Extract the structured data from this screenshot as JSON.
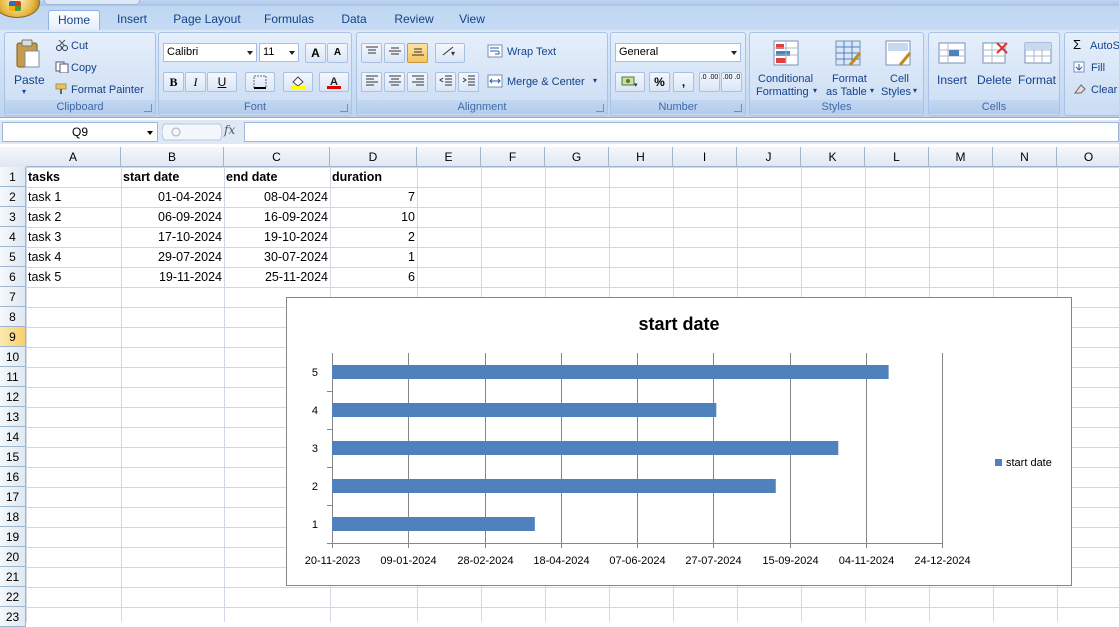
{
  "tabs": [
    {
      "label": "Home",
      "active": true
    },
    {
      "label": "Insert"
    },
    {
      "label": "Page Layout"
    },
    {
      "label": "Formulas"
    },
    {
      "label": "Data"
    },
    {
      "label": "Review"
    },
    {
      "label": "View"
    }
  ],
  "clipboard": {
    "paste": "Paste",
    "cut": "Cut",
    "copy": "Copy",
    "format_painter": "Format Painter",
    "label": "Clipboard"
  },
  "font": {
    "name": "Calibri",
    "size": "11",
    "bold": "B",
    "italic": "I",
    "underline": "U",
    "grow": "A",
    "shrink": "A",
    "label": "Font"
  },
  "alignment": {
    "wrap_text": "Wrap Text",
    "merge_center": "Merge & Center",
    "label": "Alignment"
  },
  "number": {
    "format": "General",
    "percent": "%",
    "comma": ",",
    "inc_dec": ".0 .00",
    "dec_dec": ".00 .0",
    "label": "Number"
  },
  "styles": {
    "conditional_1": "Conditional",
    "conditional_2": "Formatting",
    "format_table_1": "Format",
    "format_table_2": "as Table",
    "cell_styles_1": "Cell",
    "cell_styles_2": "Styles",
    "label": "Styles"
  },
  "cells": {
    "insert": "Insert",
    "delete": "Delete",
    "format": "Format",
    "label": "Cells"
  },
  "editing": {
    "autosum": "AutoS",
    "fill": "Fill",
    "clear": "Clear"
  },
  "namebox": "Q9",
  "fx": "fx",
  "columns": [
    "A",
    "B",
    "C",
    "D",
    "E",
    "F",
    "G",
    "H",
    "I",
    "J",
    "K",
    "L",
    "M",
    "N",
    "O"
  ],
  "rows": [
    "1",
    "2",
    "3",
    "4",
    "5",
    "6",
    "7",
    "8",
    "9",
    "10",
    "11",
    "12",
    "13",
    "14",
    "15",
    "16",
    "17",
    "18",
    "19",
    "20",
    "21",
    "22",
    "23"
  ],
  "selected_row": 9,
  "table": {
    "headers": [
      "tasks",
      "start date",
      "end date",
      "duration"
    ],
    "rows": [
      [
        "task 1",
        "01-04-2024",
        "08-04-2024",
        "7"
      ],
      [
        "task 2",
        "06-09-2024",
        "16-09-2024",
        "10"
      ],
      [
        "task 3",
        "17-10-2024",
        "19-10-2024",
        "2"
      ],
      [
        "task 4",
        "29-07-2024",
        "30-07-2024",
        "1"
      ],
      [
        "task 5",
        "19-11-2024",
        "25-11-2024",
        "6"
      ]
    ]
  },
  "chart_data": {
    "type": "bar",
    "orientation": "horizontal",
    "title": "start date",
    "categories": [
      "1",
      "2",
      "3",
      "4",
      "5"
    ],
    "series": [
      {
        "name": "start date",
        "values": [
          "2024-04-01",
          "2024-09-06",
          "2024-10-17",
          "2024-07-29",
          "2024-11-19"
        ]
      }
    ],
    "xlim": [
      "2023-11-20",
      "2024-12-24"
    ],
    "x_ticks": [
      "20-11-2023",
      "09-01-2024",
      "28-02-2024",
      "18-04-2024",
      "07-06-2024",
      "27-07-2024",
      "15-09-2024",
      "04-11-2024",
      "24-12-2024"
    ],
    "grid": "vertical",
    "legend": "right",
    "color": "#4f81bd"
  }
}
